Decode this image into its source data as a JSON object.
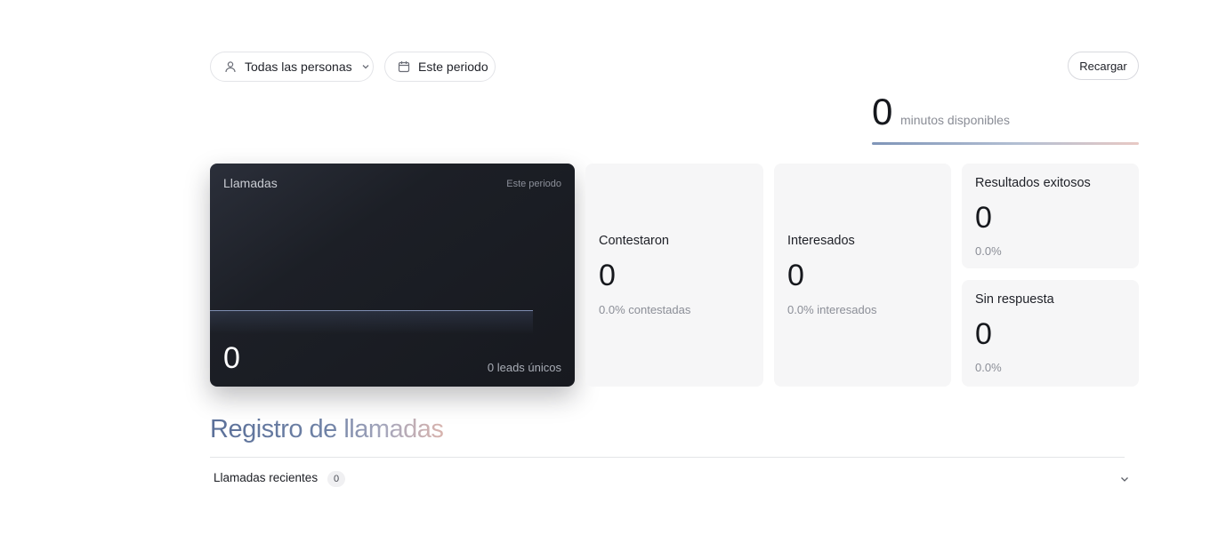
{
  "filters": {
    "persons_label": "Todas las personas",
    "period_label": "Este periodo"
  },
  "toolbar": {
    "reload_label": "Recargar"
  },
  "minutes": {
    "value": "0",
    "label": "minutos disponibles"
  },
  "calls_card": {
    "title": "Llamadas",
    "period": "Este periodo",
    "value": "0",
    "leads": "0 leads únicos"
  },
  "stats": {
    "answered": {
      "title": "Contestaron",
      "value": "0",
      "sub": "0.0% contestadas"
    },
    "interested": {
      "title": "Interesados",
      "value": "0",
      "sub": "0.0% interesados"
    },
    "success": {
      "title": "Resultados exitosos",
      "value": "0",
      "sub": "0.0%"
    },
    "no_answer": {
      "title": "Sin respuesta",
      "value": "0",
      "sub": "0.0%"
    }
  },
  "call_log": {
    "title": "Registro de llamadas",
    "recent_label": "Llamadas recientes",
    "recent_count": "0"
  },
  "icons": {
    "persons": "user-icon",
    "period": "calendar-icon",
    "dropdown": "chevron-down-icon",
    "expand": "chevron-down-icon"
  },
  "colors": {
    "dark_card": "#1c1f26",
    "stat_card": "#f6f6f7",
    "accent_line": "#7e8db0"
  }
}
